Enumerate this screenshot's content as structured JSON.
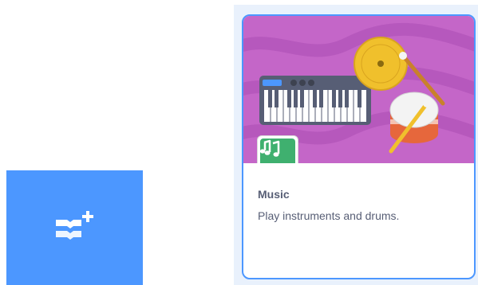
{
  "add_extension_button": {
    "icon": "add-extension-icon",
    "color": "#4c97ff"
  },
  "extension_card": {
    "name": "Music",
    "description": "Play instruments and drums.",
    "badge_icon": "music-notes-icon",
    "hero_image": "piano-cymbal-drum",
    "border_color": "#4c97ff",
    "hero_color": "#c466c8",
    "badge_color": "#3fb06f"
  }
}
